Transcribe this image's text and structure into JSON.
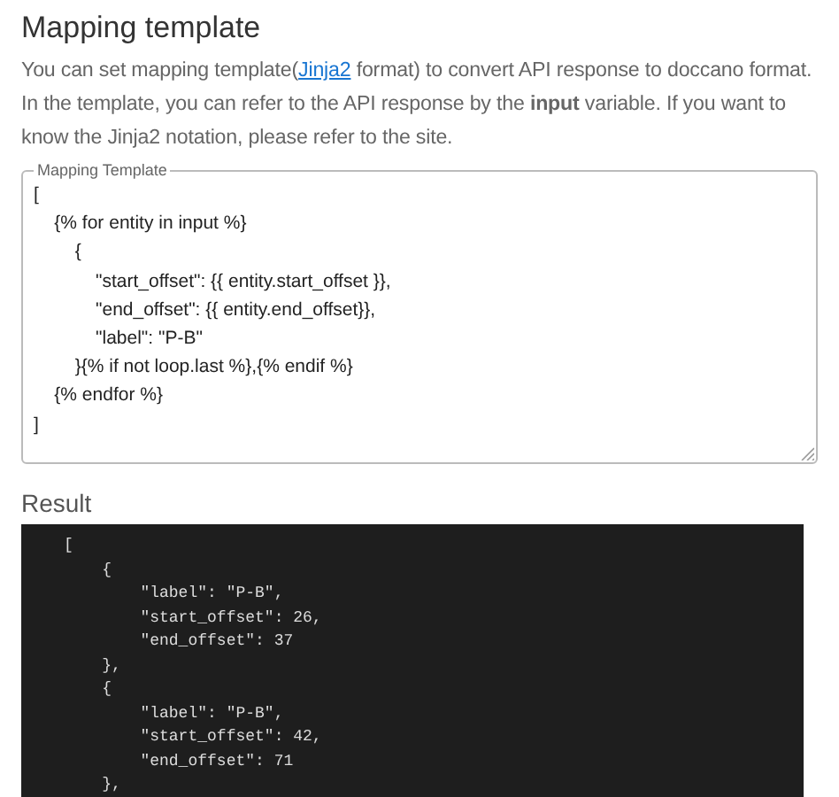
{
  "title": "Mapping template",
  "description": {
    "before": "You can set mapping template(",
    "link": "Jinja2",
    "after": " format) to convert API response to doccano format. In the template, you can refer to the API response by the **input** variable. If you want to know the Jinja2 notation, please refer to the site."
  },
  "template_field": {
    "label": "Mapping Template",
    "value": "[\n    {% for entity in input %}\n        {\n            \"start_offset\": {{ entity.start_offset }},\n            \"end_offset\": {{ entity.end_offset}},\n            \"label\": \"P-B\"\n        }{% if not loop.last %},{% endif %}\n    {% endfor %}\n]"
  },
  "result": {
    "title": "Result",
    "code": "[\n    {\n        \"label\": \"P-B\",\n        \"start_offset\": 26,\n        \"end_offset\": 37\n    },\n    {\n        \"label\": \"P-B\",\n        \"start_offset\": 42,\n        \"end_offset\": 71\n    },"
  }
}
